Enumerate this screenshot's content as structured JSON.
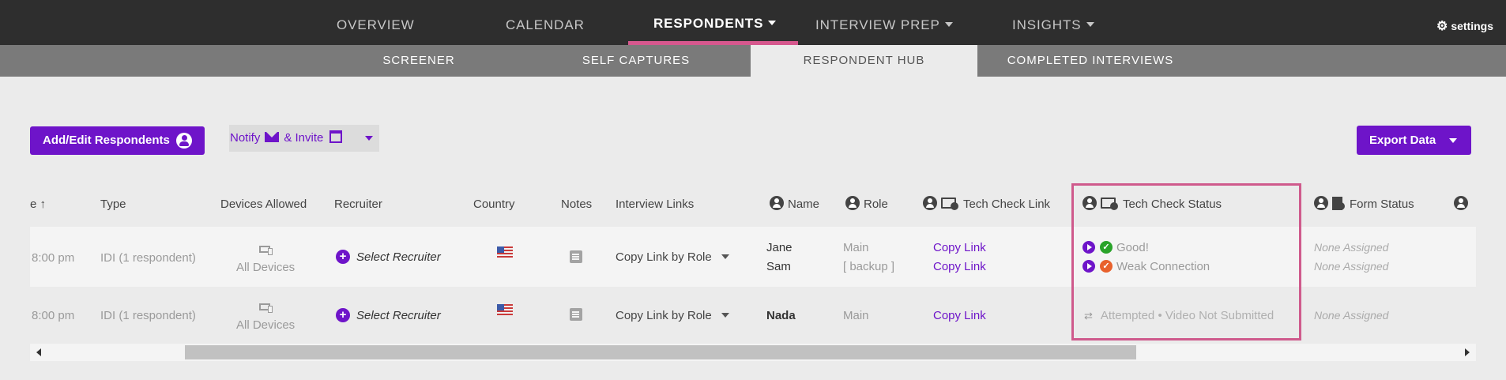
{
  "top_nav": {
    "items": [
      {
        "label": "OVERVIEW"
      },
      {
        "label": "CALENDAR"
      },
      {
        "label": "RESPONDENTS"
      },
      {
        "label": "INTERVIEW PREP"
      },
      {
        "label": "INSIGHTS"
      }
    ],
    "settings_label": "settings",
    "accent_color": "#d6588e"
  },
  "sub_nav": {
    "items": [
      {
        "label": "SCREENER"
      },
      {
        "label": "SELF CAPTURES"
      },
      {
        "label": "RESPONDENT HUB"
      },
      {
        "label": "COMPLETED INTERVIEWS"
      }
    ]
  },
  "toolbar": {
    "add_edit_label": "Add/Edit Respondents",
    "notify_label": "Notify",
    "invite_label": "& Invite",
    "export_label": "Export Data",
    "brand_color": "#6e14c9"
  },
  "table": {
    "headers": {
      "time": "e",
      "type": "Type",
      "devices": "Devices Allowed",
      "recruiter": "Recruiter",
      "country": "Country",
      "notes": "Notes",
      "links": "Interview Links",
      "name": "Name",
      "role": "Role",
      "tech_link": "Tech Check Link",
      "tech_status": "Tech Check Status",
      "form_status": "Form Status"
    },
    "rows": [
      {
        "time": "8:00 pm",
        "type": "IDI (1 respondent)",
        "devices": "All Devices",
        "recruiter": "Select Recruiter",
        "links": "Copy Link by Role",
        "people": [
          {
            "name": "Jane",
            "role": "Main",
            "tech_link": "Copy Link",
            "tech_status": "Good!",
            "form_status": "None Assigned"
          },
          {
            "name": "Sam",
            "role": "[ backup ]",
            "tech_link": "Copy Link",
            "tech_status": "Weak Connection",
            "form_status": "None Assigned"
          }
        ]
      },
      {
        "time": "8:00 pm",
        "type": "IDI (1 respondent)",
        "devices": "All Devices",
        "recruiter": "Select Recruiter",
        "links": "Copy Link by Role",
        "people": [
          {
            "name": "Nada",
            "role": "Main",
            "tech_link": "Copy Link",
            "tech_status": "Attempted • Video Not Submitted",
            "form_status": "None Assigned"
          }
        ]
      }
    ]
  }
}
